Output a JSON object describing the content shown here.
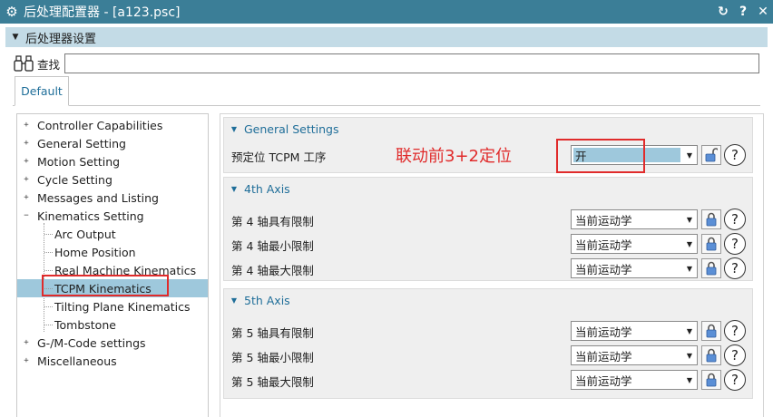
{
  "window": {
    "title": "后处理配置器 - [a123.psc]",
    "app_icon": "gear-icon",
    "buttons": [
      {
        "name": "refresh-icon",
        "glyph": "↻"
      },
      {
        "name": "help-icon",
        "glyph": "?"
      },
      {
        "name": "close-icon",
        "glyph": "✕"
      }
    ]
  },
  "section": {
    "title": "后处理器设置"
  },
  "search": {
    "label": "查找",
    "value": "",
    "icon": "binoculars-icon"
  },
  "tabs": [
    {
      "label": "Default",
      "active": true
    }
  ],
  "tree": {
    "items": [
      {
        "label": "Controller Capabilities",
        "level": 0,
        "expander": "+"
      },
      {
        "label": "General Setting",
        "level": 0,
        "expander": "+"
      },
      {
        "label": "Motion Setting",
        "level": 0,
        "expander": "+"
      },
      {
        "label": "Cycle Setting",
        "level": 0,
        "expander": "+"
      },
      {
        "label": "Messages and Listing",
        "level": 0,
        "expander": "+"
      },
      {
        "label": "Kinematics Setting",
        "level": 0,
        "expander": "−"
      },
      {
        "label": "Arc Output",
        "level": 1
      },
      {
        "label": "Home Position",
        "level": 1
      },
      {
        "label": "Real Machine Kinematics",
        "level": 1
      },
      {
        "label": "TCPM Kinematics",
        "level": 1,
        "selected": true
      },
      {
        "label": "Tilting Plane Kinematics",
        "level": 1
      },
      {
        "label": "Tombstone",
        "level": 1
      },
      {
        "label": "G-/M-Code settings",
        "level": 0,
        "expander": "+"
      },
      {
        "label": "Miscellaneous",
        "level": 0,
        "expander": "+"
      }
    ]
  },
  "groups": {
    "general": {
      "title": "General Settings",
      "rows": [
        {
          "label": "预定位 TCPM 工序",
          "value": "开",
          "lock": "unlocked"
        }
      ]
    },
    "axis4": {
      "title": "4th Axis",
      "rows": [
        {
          "label": "第 4 轴具有限制",
          "value": "当前运动学",
          "lock": "locked"
        },
        {
          "label": "第 4 轴最小限制",
          "value": "当前运动学",
          "lock": "locked"
        },
        {
          "label": "第 4 轴最大限制",
          "value": "当前运动学",
          "lock": "locked"
        }
      ]
    },
    "axis5": {
      "title": "5th Axis",
      "rows": [
        {
          "label": "第 5 轴具有限制",
          "value": "当前运动学",
          "lock": "locked"
        },
        {
          "label": "第 5 轴最小限制",
          "value": "当前运动学",
          "lock": "locked"
        },
        {
          "label": "第 5 轴最大限制",
          "value": "当前运动学",
          "lock": "locked"
        }
      ]
    }
  },
  "annotation": {
    "text": "联动前3+2定位",
    "color": "#e02b2b"
  },
  "colors": {
    "titlebar": "#3b7e97",
    "section_header": "#c3dbe6",
    "selection": "#9ec8dc",
    "accent_text": "#1f6e99",
    "annotation_red": "#e02b2b"
  }
}
